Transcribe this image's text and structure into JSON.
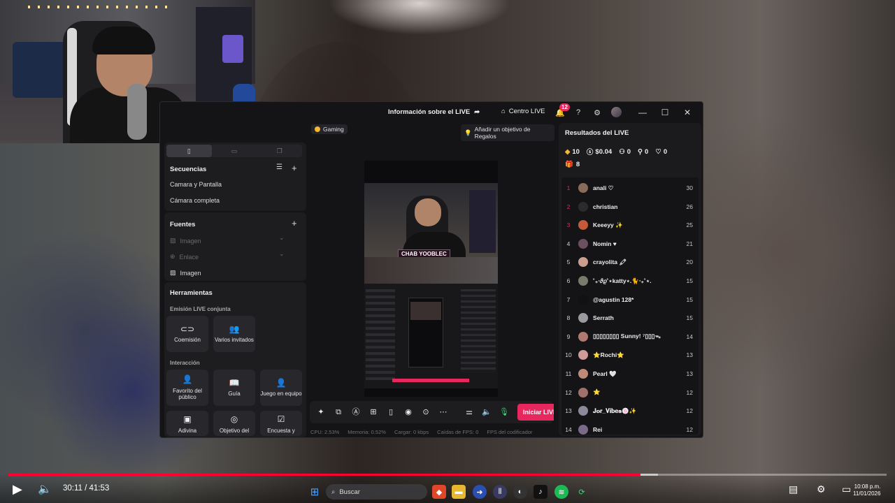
{
  "titlebar": {
    "info_label": "Información sobre el LIVE",
    "centro_label": "Centro LIVE",
    "notif_count": "12"
  },
  "left": {
    "secuencias_title": "Secuencias",
    "secuencias": [
      "Camara y Pantalla",
      "Cámara completa"
    ],
    "fuentes_title": "Fuentes",
    "fuentes": [
      {
        "label": "Imagen",
        "dim": true
      },
      {
        "label": "Enlace",
        "dim": true
      },
      {
        "label": "Imagen",
        "dim": false
      }
    ],
    "herramientas_title": "Herramientas",
    "emision_label": "Emisión LIVE conjunta",
    "emision_tools": [
      "Coemisión",
      "Varios invitados"
    ],
    "interaccion_label": "Interacción",
    "interaccion_tools": [
      "Favorito del público",
      "Guía",
      "Juego en equipo"
    ],
    "more_tools": [
      "Adivina",
      "Objetivo del",
      "Encuesta y"
    ]
  },
  "center": {
    "category": "Gaming",
    "goal_label": "Añadir un objetivo de Regalos",
    "overlay_tag": "CHAB YOOBLEC",
    "start_button": "Iniciar LIVE",
    "stats": [
      {
        "label": "CPU:",
        "value": "2.53%"
      },
      {
        "label": "Memoria:",
        "value": "0.52%"
      },
      {
        "label": "Cargar:",
        "value": "0 kbps"
      },
      {
        "label": "Caídas de FPS:",
        "value": "0"
      },
      {
        "label": "FPS del codificador",
        "value": ""
      }
    ]
  },
  "results": {
    "title": "Resultados del LIVE",
    "diamonds": "10",
    "money": "$0.04",
    "viewers": "0",
    "followers": "0",
    "likes": "0",
    "gifts": "8",
    "leaderboard": [
      {
        "rank": "1",
        "name": "anali ♡",
        "score": "30"
      },
      {
        "rank": "2",
        "name": "christian",
        "score": "26"
      },
      {
        "rank": "3",
        "name": "Keeeyy ✨",
        "score": "25"
      },
      {
        "rank": "4",
        "name": "Nomin ♥",
        "score": "21"
      },
      {
        "rank": "5",
        "name": "crayolita 🖍",
        "score": "20"
      },
      {
        "rank": "6",
        "name": "˚₊‧𝜗𝜚˚⋆katty⋆.🐈‧₊˚⋆.",
        "score": "15"
      },
      {
        "rank": "7",
        "name": "@agustin 128*",
        "score": "15"
      },
      {
        "rank": "8",
        "name": "Serrath",
        "score": "15"
      },
      {
        "rank": "9",
        "name": "▯▯▯▯▯▯▯▯ Sunny! ⁷▯▯▯ᯓ",
        "score": "14"
      },
      {
        "rank": "10",
        "name": "⭐Rochi⭐",
        "score": "13"
      },
      {
        "rank": "11",
        "name": "Pearl 🤍",
        "score": "13"
      },
      {
        "rank": "12",
        "name": "⭐",
        "score": "12"
      },
      {
        "rank": "13",
        "name": "𝐉𝐨𝐫_𝐕𝐢𝐛𝐞𝐬🍥✨",
        "score": "12"
      },
      {
        "rank": "14",
        "name": "Rei",
        "score": "12"
      }
    ]
  },
  "player": {
    "time": "30:11 / 41:53",
    "progress": 0.72,
    "buffered": 0.74
  },
  "taskbar": {
    "search_placeholder": "Buscar",
    "clock_time": "10:08 p.m.",
    "clock_date": "11/01/2026"
  },
  "colors": {
    "accent": "#e8275f",
    "mic": "#3ed67a",
    "progress": "#ff0033"
  }
}
